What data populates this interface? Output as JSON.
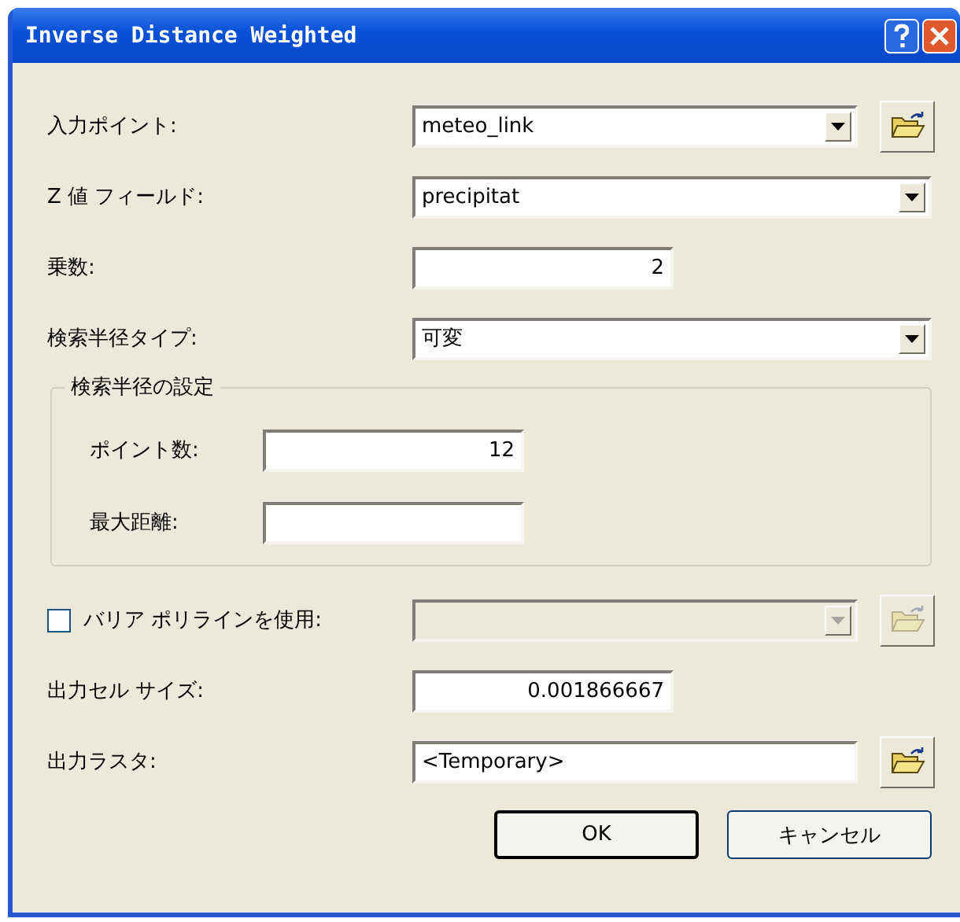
{
  "window": {
    "title": "Inverse Distance Weighted"
  },
  "rows": [
    {
      "kind": "dropdown",
      "label": "入力ポイント:",
      "value": "meteo_link",
      "browse": true
    },
    {
      "kind": "dropdown",
      "label": "Z 値 フィールド:",
      "value": "precipitat",
      "browse": false
    },
    {
      "kind": "number",
      "label": "乗数:",
      "value": "2"
    },
    {
      "kind": "dropdown",
      "label": "検索半径タイプ:",
      "value": "可変",
      "browse": false
    },
    {
      "kind": "group",
      "title": "検索半径の設定",
      "rows": [
        {
          "kind": "number",
          "label": "ポイント数:",
          "value": "12"
        },
        {
          "kind": "number",
          "label": "最大距離:",
          "value": ""
        }
      ]
    },
    {
      "kind": "checkbox",
      "label": "バリア ポリラインを使用:",
      "checked": false,
      "disabled": true
    },
    {
      "kind": "number",
      "label": "出力セル サイズ:",
      "value": "0.001866667"
    },
    {
      "kind": "text",
      "label": "出力ラスタ:",
      "value": "<Temporary>",
      "browse": true
    }
  ],
  "buttons": [
    {
      "label": "OK",
      "default": true
    },
    {
      "label": "キャンセル",
      "default": false
    }
  ]
}
